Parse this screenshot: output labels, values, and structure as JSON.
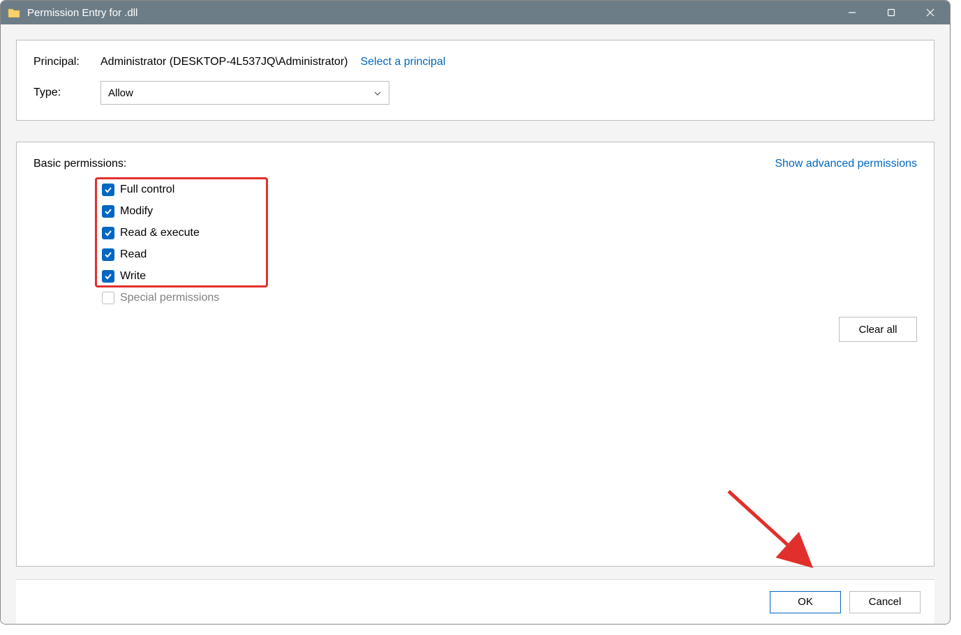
{
  "titlebar": {
    "title_prefix": "Permission Entry for",
    "title_gap": "       ",
    "title_suffix": ".dll"
  },
  "principal": {
    "label": "Principal:",
    "value": "Administrator (DESKTOP-4L537JQ\\Administrator)",
    "select_link": "Select a principal"
  },
  "type": {
    "label": "Type:",
    "selected": "Allow"
  },
  "permissions": {
    "section_title": "Basic permissions:",
    "advanced_link": "Show advanced permissions",
    "items": [
      {
        "label": "Full control",
        "checked": true,
        "disabled": false
      },
      {
        "label": "Modify",
        "checked": true,
        "disabled": false
      },
      {
        "label": "Read & execute",
        "checked": true,
        "disabled": false
      },
      {
        "label": "Read",
        "checked": true,
        "disabled": false
      },
      {
        "label": "Write",
        "checked": true,
        "disabled": false
      },
      {
        "label": "Special permissions",
        "checked": false,
        "disabled": true
      }
    ],
    "clear_all": "Clear all"
  },
  "footer": {
    "ok": "OK",
    "cancel": "Cancel"
  },
  "annotation": {
    "highlight_color": "#e1302b"
  }
}
